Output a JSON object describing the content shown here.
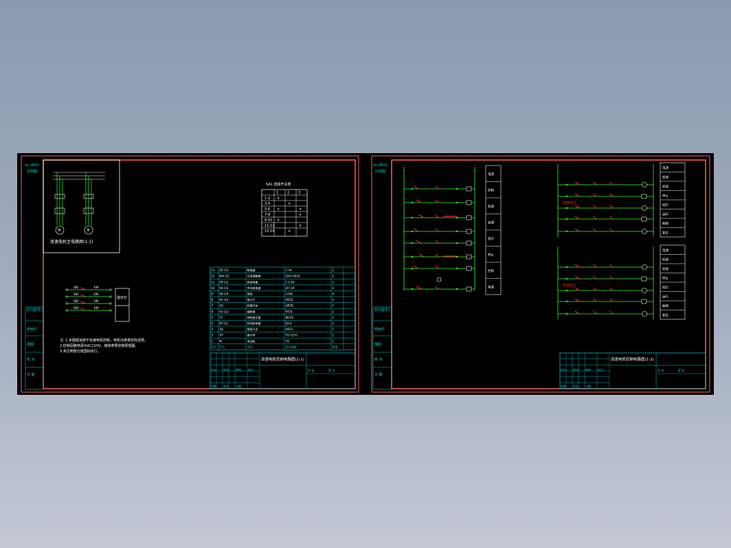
{
  "colors": {
    "background": "#000000",
    "frame": "#ff6060",
    "border": "#ffffff",
    "title_block": "#00d0d0",
    "circuit_line": "#30ff30",
    "contact": "#ff2020",
    "note_text": "#ffff40",
    "label": "#ffffff"
  },
  "sheets": [
    {
      "corner_note": "Se-W02S",
      "corner_note_2": "比例图",
      "side_labels": [
        "原件图号1",
        "借用件",
        "描图",
        "校 对",
        "日 期"
      ],
      "motor_caption": "双速电机主电路图(1-1)",
      "selector_table": {
        "title": "SA1 选择开关表",
        "headers": [
          "",
          "1",
          "2",
          "3"
        ],
        "rows": [
          [
            "1-2",
            "×",
            "",
            ""
          ],
          [
            "3-4",
            "",
            "×",
            ""
          ],
          [
            "5-6",
            "×",
            "",
            "×"
          ],
          [
            "7-8",
            "",
            "",
            "×"
          ],
          [
            "9-10",
            "×",
            "",
            ""
          ],
          [
            "11-12",
            "",
            "",
            "×"
          ],
          [
            "13-14",
            "",
            "×",
            ""
          ]
        ]
      },
      "contact_labels": [
        "SB1",
        "SB2",
        "SB3",
        "SB4"
      ],
      "indicator_box": "指示灯",
      "note_lines": [
        "注: 1.本图纸适用于双速电机控制，电机功率按实际选择。",
        "2.控制回路电源为AC220V，接线参照控制原理图。",
        "3.未注明部分按国标执行。"
      ],
      "parts_list": [
        [
          "13",
          "QF-1/2",
          "断路器",
          "1-3A",
          "2"
        ],
        [
          "12",
          "KM-1/2",
          "交流接触器",
          "CJX2-0910",
          "2"
        ],
        [
          "11",
          "FR-1/2",
          "热继电器",
          "1-1.6A",
          "2"
        ],
        [
          "10",
          "KA-1/2",
          "中间继电器",
          "JZ7-44",
          "2"
        ],
        [
          "9",
          "SB-1/4",
          "按钮",
          "LA38",
          "4"
        ],
        [
          "8",
          "HL-1/4",
          "指示灯",
          "AD16",
          "4"
        ],
        [
          "7",
          "SA",
          "转换开关",
          "LW5D",
          "1"
        ],
        [
          "6",
          "FU-1/2",
          "熔断器",
          "RT18",
          "2"
        ],
        [
          "5",
          "TC",
          "控制变压器",
          "BK-50",
          "1"
        ],
        [
          "4",
          "KT-1/2",
          "时间继电器",
          "JS14",
          "2"
        ],
        [
          "3",
          "QS",
          "隔离开关",
          "HD11",
          "1"
        ],
        [
          "2",
          "XT",
          "端子排",
          "TD-1510",
          "1"
        ],
        [
          "1",
          "M",
          "电动机",
          "YD",
          "1"
        ]
      ],
      "parts_headers": [
        "序号",
        "代号",
        "名称",
        "型号规格",
        "数量"
      ],
      "title": "双速电机控制电路图(1-1)",
      "title_cells": [
        "设计",
        "校对",
        "审核",
        "标记",
        "处数",
        "签名",
        "日期",
        "共 张",
        "第 张"
      ]
    },
    {
      "corner_note": "Se-W02S",
      "corner_note_2": "比例图",
      "side_labels": [
        "原件图号1",
        "借用件",
        "描图",
        "校 对",
        "日 期"
      ],
      "left_legend": [
        "电源",
        "控制",
        "低速",
        "高速",
        "指示",
        "停止",
        "控制",
        "电源"
      ],
      "right_legend_top": [
        "电源",
        "低速",
        "高速",
        "停止",
        "指示",
        "运行",
        "故障",
        "复位"
      ],
      "right_legend_bottom": [
        "电源",
        "低速",
        "高速",
        "停止",
        "指示",
        "运行",
        "故障",
        "复位"
      ],
      "mark_text": "低速运行",
      "title": "双速电机控制电路图(1-2)",
      "title_cells": [
        "设计",
        "校对",
        "审核",
        "标记",
        "处数",
        "签名",
        "日期",
        "共 张",
        "第 张"
      ]
    }
  ]
}
